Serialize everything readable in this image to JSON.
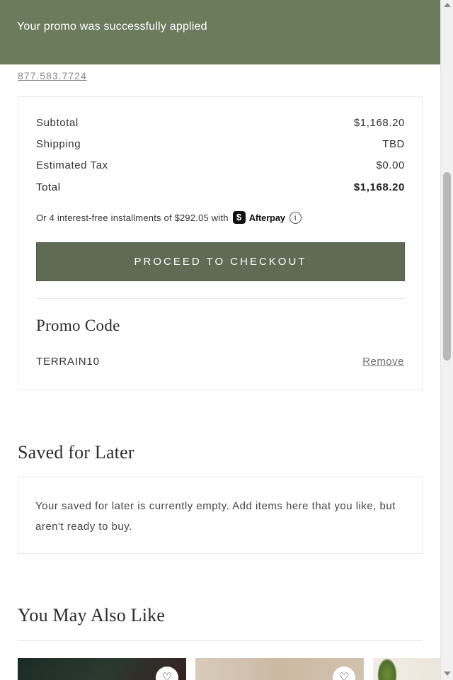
{
  "toast": {
    "message": "Your promo was successfully applied"
  },
  "contact": {
    "phone": "877.583.7724"
  },
  "summary": {
    "rows": [
      {
        "label": "Subtotal",
        "value": "$1,168.20"
      },
      {
        "label": "Shipping",
        "value": "TBD"
      },
      {
        "label": "Estimated Tax",
        "value": "$0.00"
      },
      {
        "label": "Total",
        "value": "$1,168.20"
      }
    ],
    "afterpay_text": "Or 4 interest-free installments of $292.05 with",
    "afterpay_brand": "Afterpay",
    "afterpay_badge": "$",
    "checkout_label": "PROCEED TO CHECKOUT"
  },
  "promo": {
    "title": "Promo Code",
    "code": "TERRAIN10",
    "remove_label": "Remove"
  },
  "saved_for_later": {
    "title": "Saved for Later",
    "empty_message": "Your saved for later is currently empty. Add items here that you like, but aren't ready to buy."
  },
  "recommendations": {
    "title": "You May Also Like",
    "heart_glyph": "♡"
  },
  "colors": {
    "toast_bg": "#6b7b5c",
    "checkout_bg": "#5f6b55"
  }
}
